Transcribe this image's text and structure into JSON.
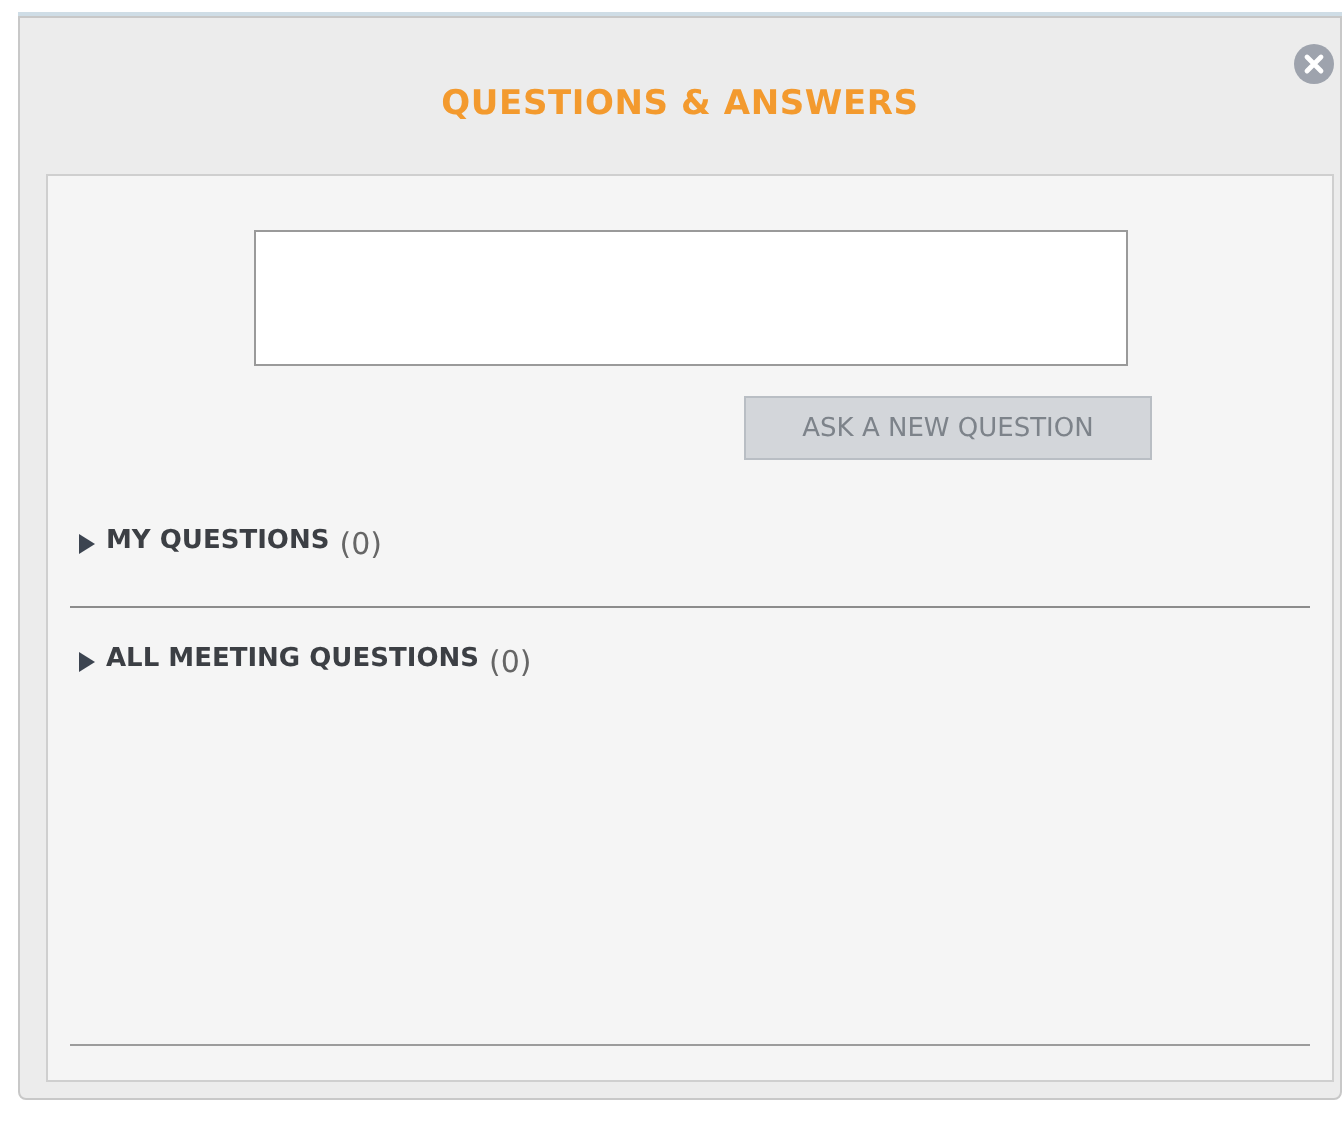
{
  "window": {
    "title": "QUESTIONS & ANSWERS"
  },
  "ask_button": {
    "label": "ASK A NEW QUESTION",
    "disabled": true
  },
  "sections": [
    {
      "label": "MY QUESTIONS",
      "count": "(0)",
      "expanded": false
    },
    {
      "label": "ALL MEETING QUESTIONS",
      "count": "(0)",
      "expanded": false
    }
  ]
}
